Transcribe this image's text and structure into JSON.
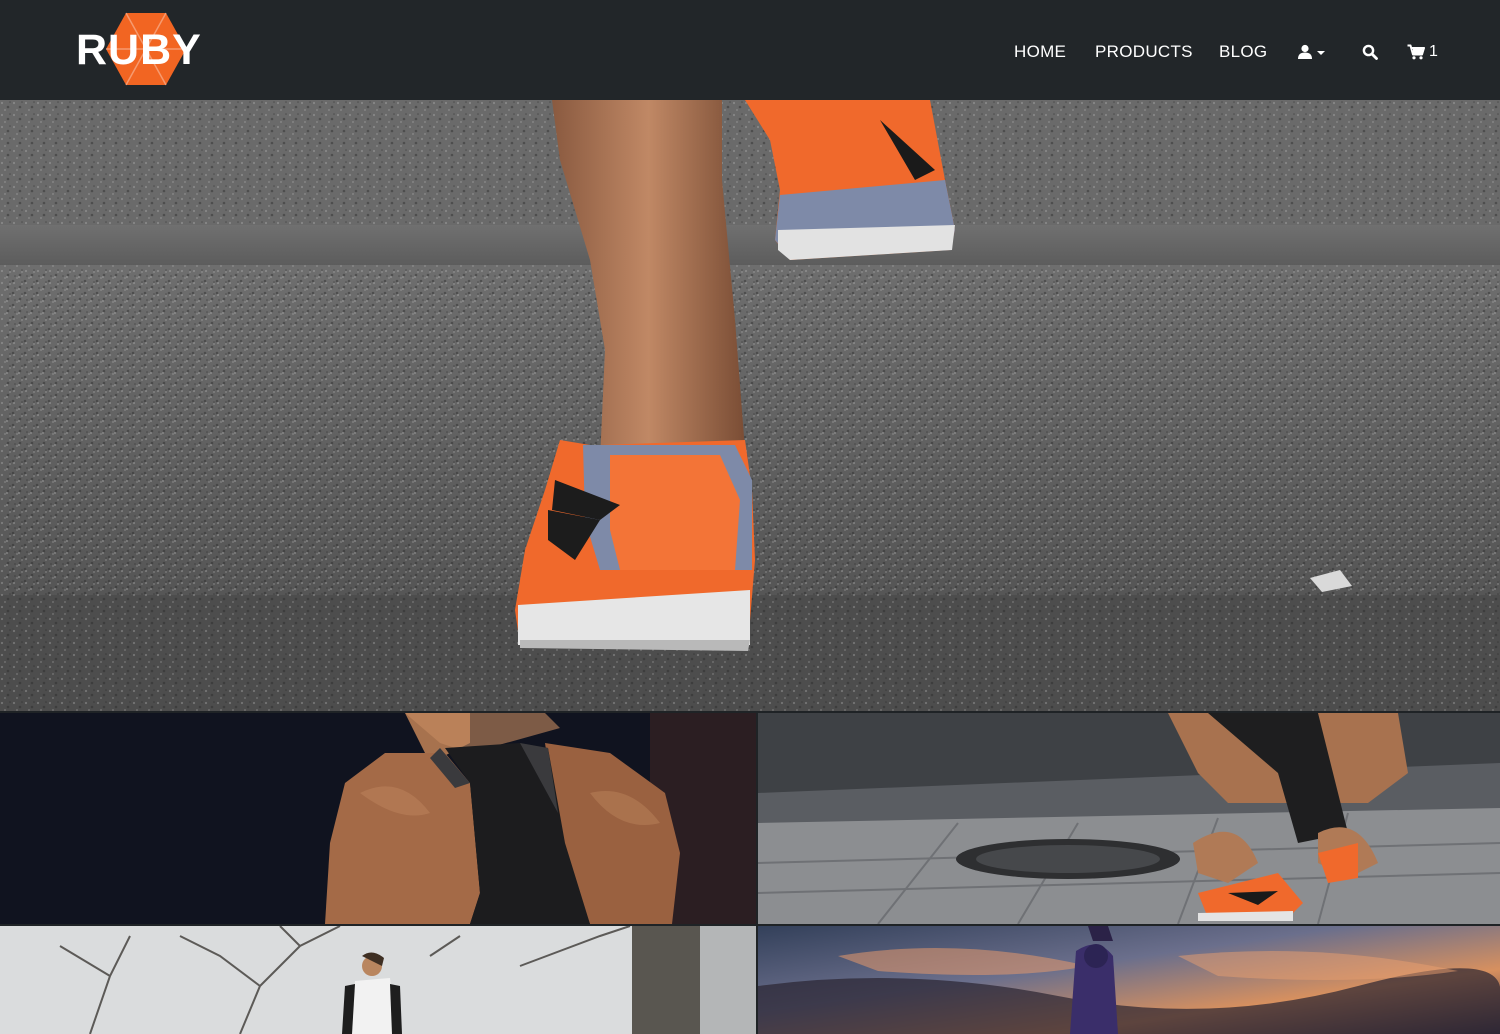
{
  "brand": {
    "logo_text": "RUBY",
    "accent_color": "#f26522"
  },
  "nav": {
    "items": [
      {
        "label": "HOME"
      },
      {
        "label": "PRODUCTS"
      },
      {
        "label": "BLOG"
      }
    ],
    "account_icon": "user-icon",
    "account_dropdown_icon": "caret-down-icon",
    "search_icon": "search-icon",
    "cart_icon": "shopping-cart-icon",
    "cart_count": "1"
  },
  "gallery": {
    "hero": {
      "icon": "image-runner-shoes-stairs"
    },
    "tiles": [
      {
        "icon": "image-athlete-back"
      },
      {
        "icon": "image-runner-tying-shoe"
      },
      {
        "icon": "image-woman-running-forest"
      },
      {
        "icon": "image-runner-sunset"
      }
    ]
  }
}
